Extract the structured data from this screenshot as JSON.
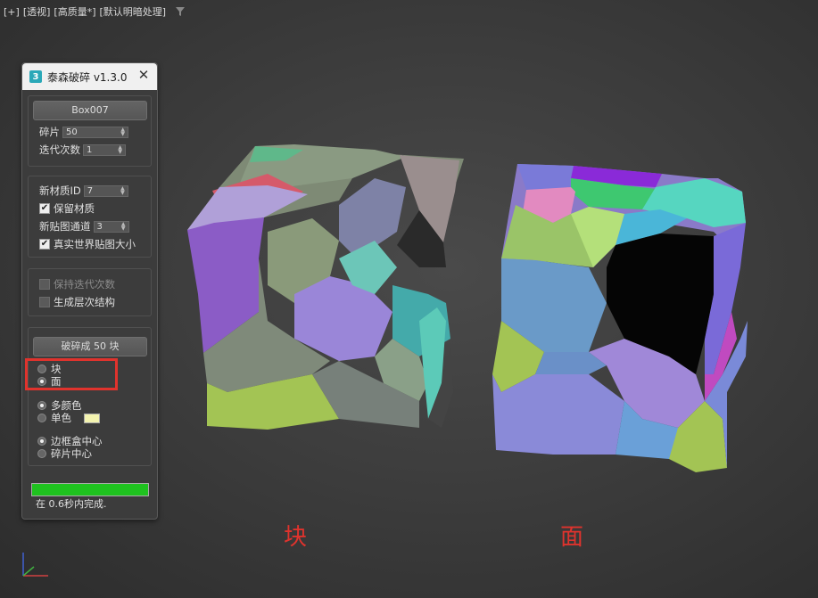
{
  "viewport": {
    "label_plus": "[+]",
    "label_view": "[透视]",
    "label_quality": "[高质量*]",
    "label_lighting": "[默认明暗处理]"
  },
  "panel": {
    "title": "泰森破碎 v1.3.0",
    "app_icon_text": "3",
    "object_button": "Box007",
    "fragments_label": "碎片",
    "fragments_value": "50",
    "iterations_label": "迭代次数",
    "iterations_value": "1",
    "material_id_label": "新材质ID",
    "material_id_value": "7",
    "keep_material_label": "保留材质",
    "map_channel_label": "新贴图通道",
    "map_channel_value": "3",
    "real_world_label": "真实世界贴图大小",
    "keep_iterations_label": "保持迭代次数",
    "hierarchy_label": "生成层次结构",
    "break_button": "破碎成 50 块",
    "mode_block": "块",
    "mode_face": "面",
    "multi_color": "多颜色",
    "single_color": "单色",
    "pivot_bbox": "边框盒中心",
    "pivot_fragment": "碎片中心",
    "progress_fraction": 1.0,
    "status_text": "在 0.6秒内完成."
  },
  "captions": {
    "left": "块",
    "right": "面"
  },
  "colors": {
    "highlight": "#e0332d",
    "progress": "#1fc21f",
    "single_color_swatch": "#f4f4b0"
  }
}
